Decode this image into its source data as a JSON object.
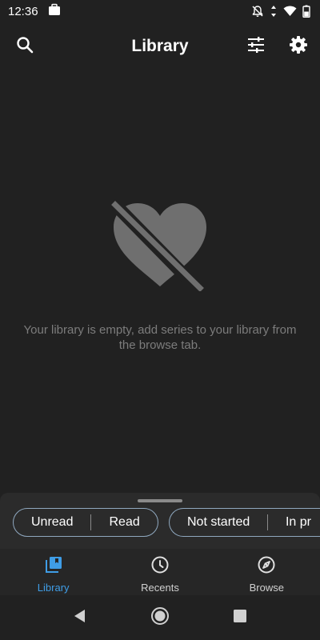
{
  "status_bar": {
    "time": "12:36",
    "icons": [
      "briefcase-icon",
      "notifications-off-icon",
      "data-arrows-icon",
      "wifi-icon",
      "battery-icon"
    ]
  },
  "app_bar": {
    "title": "Library",
    "icons": [
      "search-icon",
      "filter-icon",
      "gear-icon"
    ]
  },
  "empty_state": {
    "icon": "heart-off-icon",
    "message": "Your library is empty, add series to your library from the browse tab."
  },
  "filters": {
    "read_status": [
      "Unread",
      "Read"
    ],
    "progress": [
      "Not started",
      "In pr"
    ]
  },
  "bottom_nav": {
    "items": [
      {
        "label": "Library",
        "icon": "library-icon",
        "active": true
      },
      {
        "label": "Recents",
        "icon": "clock-icon",
        "active": false
      },
      {
        "label": "Browse",
        "icon": "compass-icon",
        "active": false
      }
    ]
  },
  "system_nav": {
    "icons": [
      "back-icon",
      "home-icon",
      "overview-icon"
    ]
  },
  "colors": {
    "background": "#212121",
    "accent": "#3f9de6",
    "muted_text": "#7c7c7c",
    "chip_border": "#8fa8bf"
  }
}
